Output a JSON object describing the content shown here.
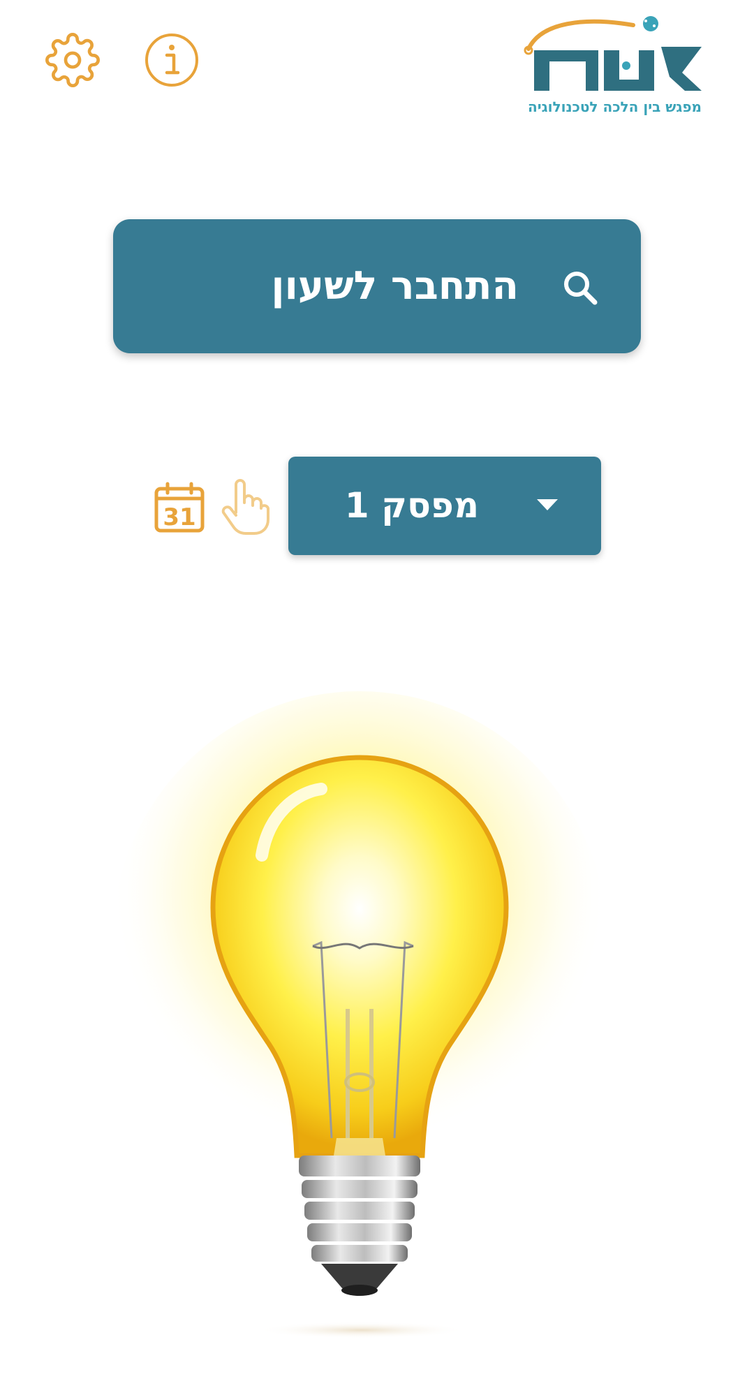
{
  "header": {
    "settings_icon": "gear-icon",
    "info_icon": "info-icon",
    "logo": {
      "name": "צמת",
      "tagline": "מפגש בין הלכה לטכנולוגיה"
    }
  },
  "main": {
    "connect_button": {
      "label": "התחבר לשעון",
      "icon": "search-icon"
    },
    "switch_selector": {
      "selected": "מפסק 1",
      "icon": "chevron-down-icon"
    },
    "tap_icon": "hand-pointer-icon",
    "calendar_icon": {
      "name": "calendar-icon",
      "day": "31"
    },
    "light_state_image": "light-bulb-on"
  },
  "colors": {
    "primary": "#377b93",
    "accent": "#e8a33a",
    "background": "#ffffff"
  }
}
